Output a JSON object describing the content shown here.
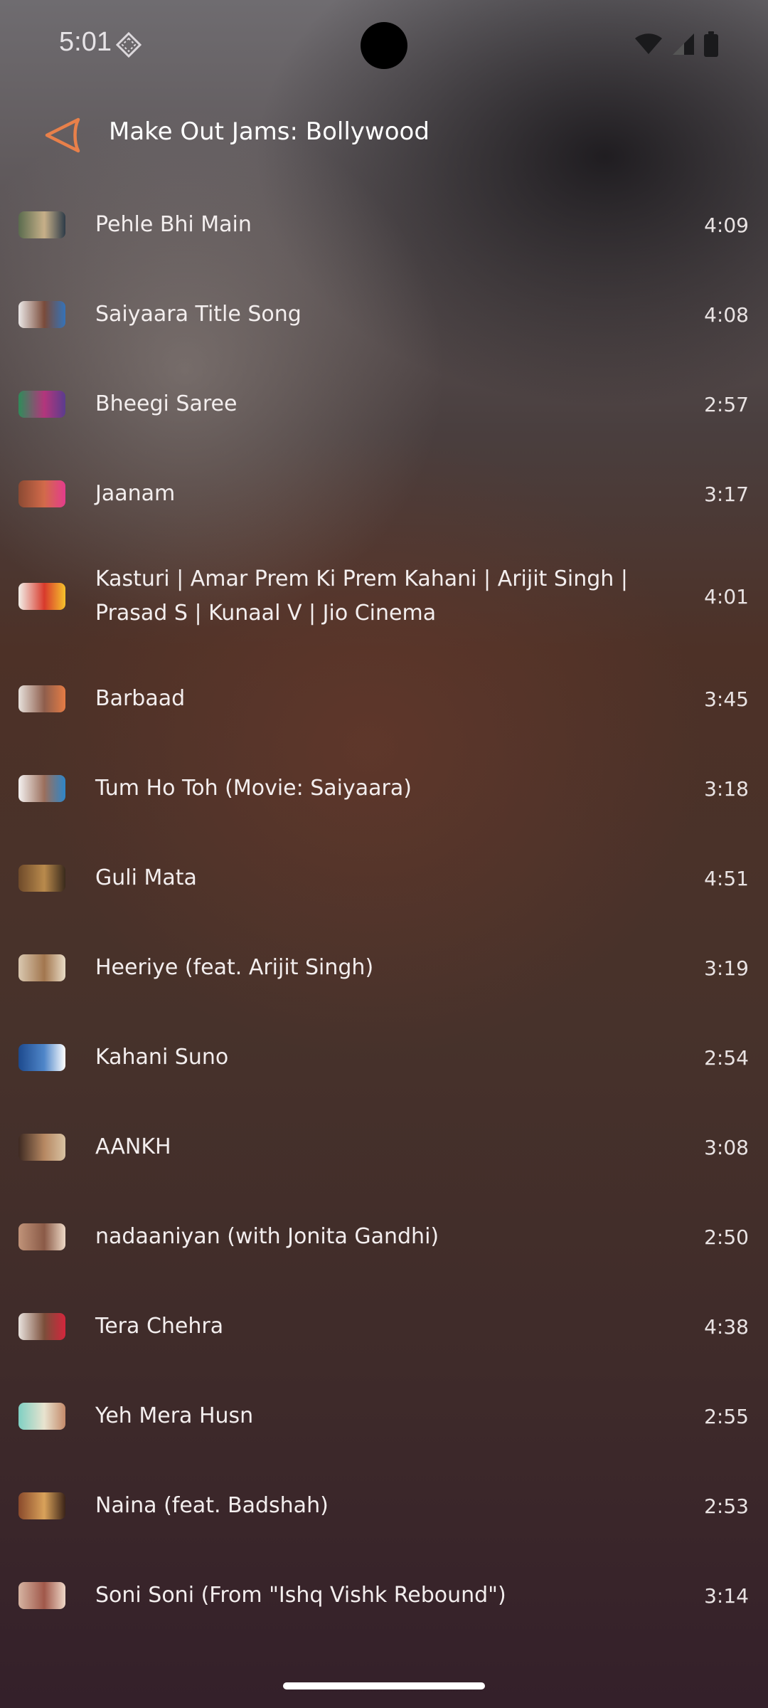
{
  "status_bar": {
    "time": "5:01"
  },
  "header": {
    "title": "Make Out Jams: Bollywood"
  },
  "tracks": [
    {
      "title": "Pehle Bhi Main",
      "duration": "4:09",
      "thumb_colors": [
        "#5a6b4e",
        "#c7b089",
        "#2d3b48"
      ]
    },
    {
      "title": "Saiyaara Title Song",
      "duration": "4:08",
      "thumb_colors": [
        "#eae7e6",
        "#7a4b3a",
        "#3573b8"
      ]
    },
    {
      "title": "Bheegi Saree",
      "duration": "2:57",
      "thumb_colors": [
        "#2f8c5a",
        "#b3367c",
        "#5a3c8e"
      ]
    },
    {
      "title": "Jaanam",
      "duration": "3:17",
      "thumb_colors": [
        "#8b4a33",
        "#d26a4a",
        "#e43c8c"
      ]
    },
    {
      "title": "Kasturi | Amar Prem Ki Prem Kahani | Arijit Singh | Prasad S | Kunaal V | Jio Cinema",
      "duration": "4:01",
      "thumb_colors": [
        "#f2efe9",
        "#d83a2c",
        "#f6c22c"
      ]
    },
    {
      "title": "Barbaad",
      "duration": "3:45",
      "thumb_colors": [
        "#e7e1dc",
        "#8e5e4c",
        "#e57c45"
      ]
    },
    {
      "title": "Tum Ho Toh (Movie: Saiyaara)",
      "duration": "3:18",
      "thumb_colors": [
        "#f4f1f0",
        "#9b6f5c",
        "#2e86c9"
      ]
    },
    {
      "title": "Guli Mata",
      "duration": "4:51",
      "thumb_colors": [
        "#6e4a2a",
        "#b98a4c",
        "#3a2a1c"
      ]
    },
    {
      "title": "Heeriye (feat. Arijit Singh)",
      "duration": "3:19",
      "thumb_colors": [
        "#d9c8b0",
        "#a2764e",
        "#e9dcc6"
      ]
    },
    {
      "title": "Kahani Suno",
      "duration": "2:54",
      "thumb_colors": [
        "#1d4a8e",
        "#4f86c9",
        "#ffffff"
      ]
    },
    {
      "title": "AANKH",
      "duration": "3:08",
      "thumb_colors": [
        "#3e2a22",
        "#b68862",
        "#d9c3a3"
      ]
    },
    {
      "title": "nadaaniyan (with Jonita Gandhi)",
      "duration": "2:50",
      "thumb_colors": [
        "#c09379",
        "#8a5a47",
        "#eed9c6"
      ]
    },
    {
      "title": "Tera Chehra",
      "duration": "4:38",
      "thumb_colors": [
        "#e9e3de",
        "#7b4e3a",
        "#d3263c"
      ]
    },
    {
      "title": "Yeh Mera Husn",
      "duration": "2:55",
      "thumb_colors": [
        "#7fd0c3",
        "#e8e3cf",
        "#c48a6a"
      ]
    },
    {
      "title": "Naina (feat. Badshah)",
      "duration": "2:53",
      "thumb_colors": [
        "#8a4a2c",
        "#d9a25a",
        "#3b2418"
      ]
    },
    {
      "title": "Soni Soni (From \"Ishq Vishk Rebound\")",
      "duration": "3:14",
      "thumb_colors": [
        "#d6b4a2",
        "#a0584a",
        "#efd8c8"
      ]
    }
  ],
  "colors": {
    "accent": "#e8804a",
    "text": "#f3eeee"
  }
}
